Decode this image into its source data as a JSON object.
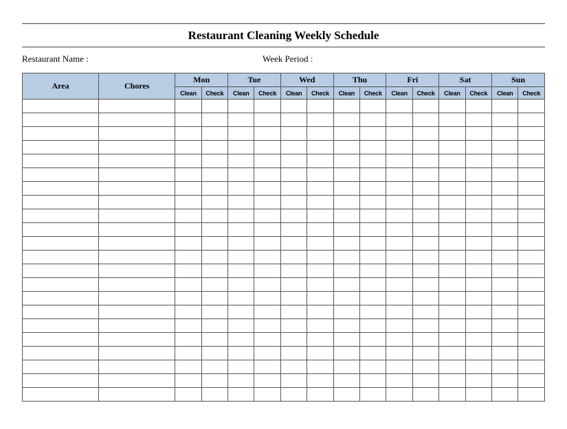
{
  "title": "Restaurant Cleaning Weekly Schedule",
  "form": {
    "restaurant_name_label": "Restaurant Name   :",
    "week_period_label": "Week  Period :"
  },
  "headers": {
    "area": "Area",
    "chores": "Chores",
    "days": [
      "Mon",
      "Tue",
      "Wed",
      "Thu",
      "Fri",
      "Sat",
      "Sun"
    ],
    "sub": {
      "clean": "Clean",
      "check": "Check"
    }
  },
  "row_count": 22
}
